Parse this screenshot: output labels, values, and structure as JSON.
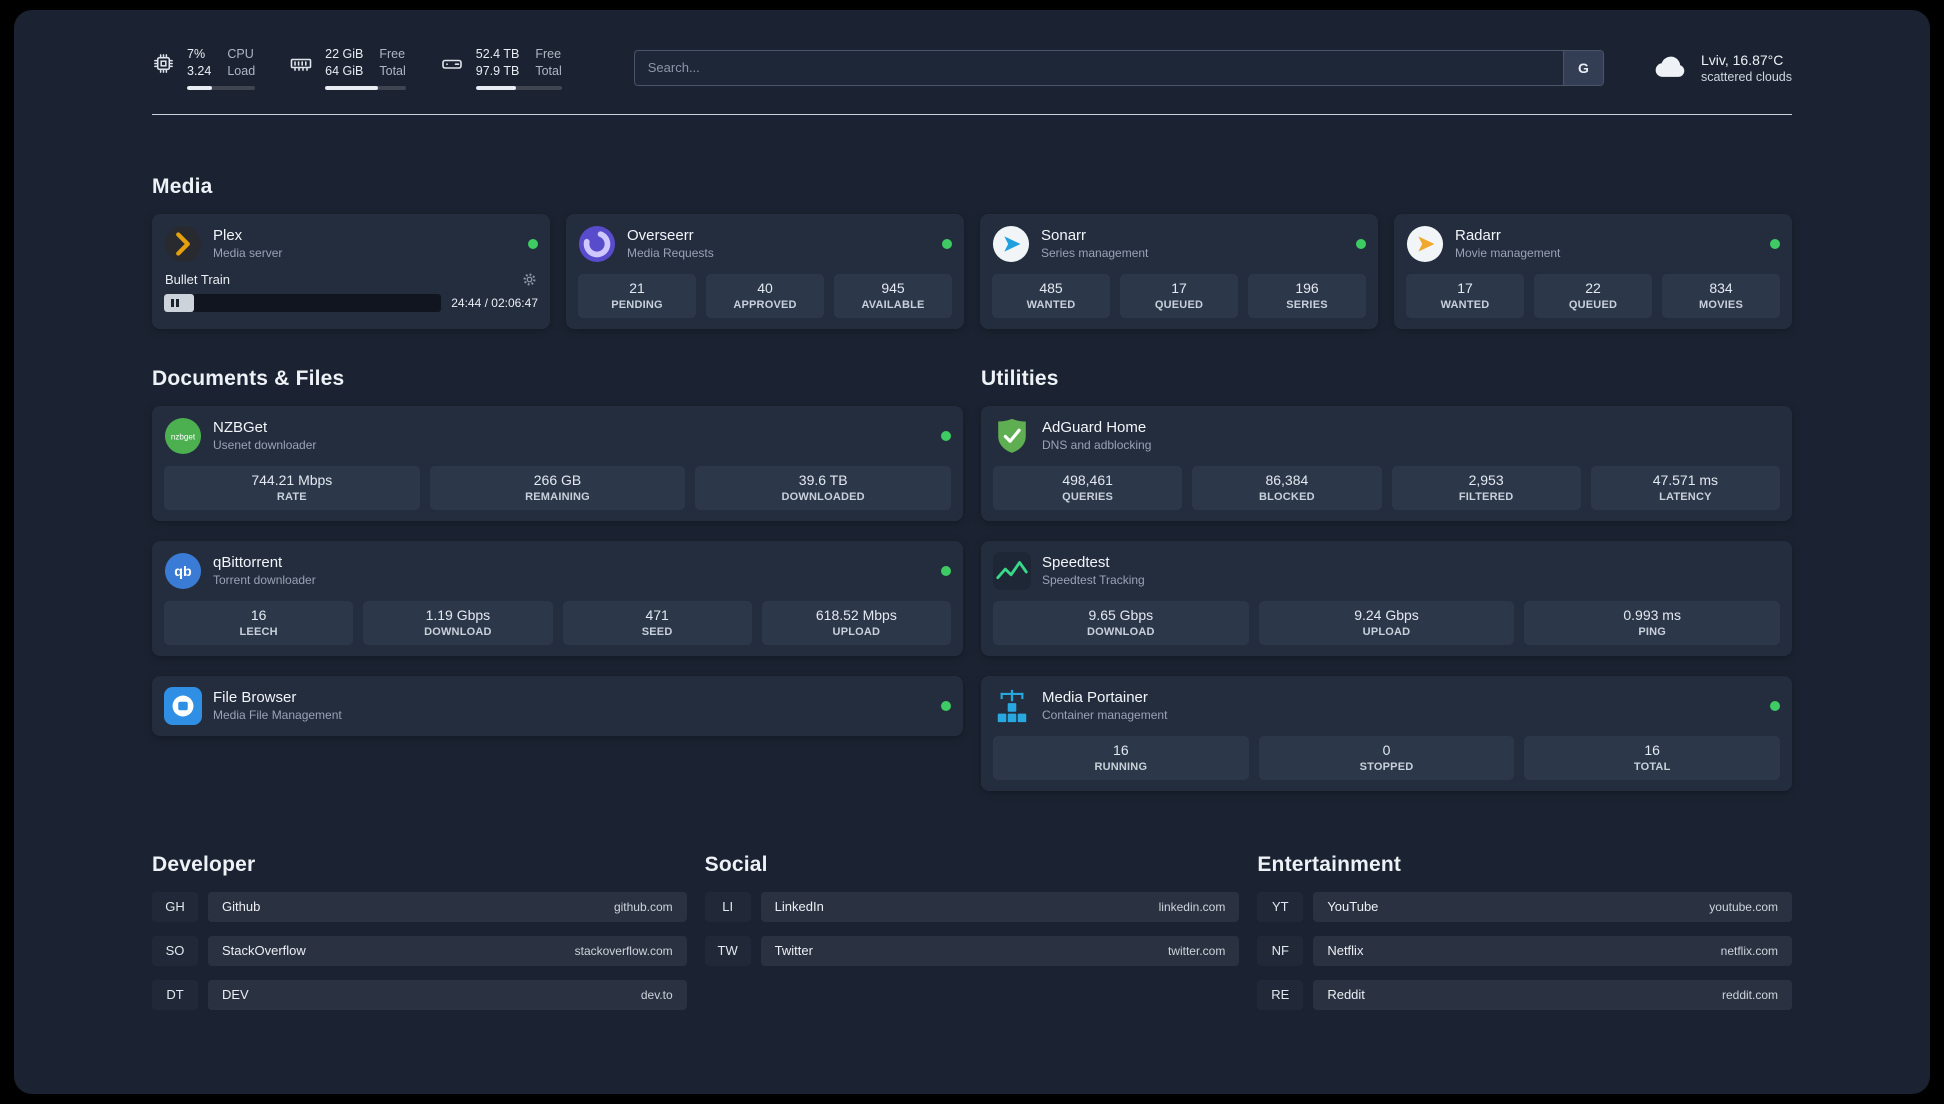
{
  "topbar": {
    "cpu": {
      "value1": "7%",
      "value2": "3.24",
      "label1": "CPU",
      "label2": "Load",
      "progress": 36
    },
    "ram": {
      "value1": "22 GiB",
      "value2": "64 GiB",
      "label1": "Free",
      "label2": "Total",
      "progress": 66
    },
    "disk": {
      "value1": "52.4 TB",
      "value2": "97.9 TB",
      "label1": "Free",
      "label2": "Total",
      "progress": 47
    },
    "search": {
      "placeholder": "Search...",
      "button_label": "G"
    },
    "weather": {
      "location": "Lviv, 16.87°C",
      "condition": "scattered clouds"
    }
  },
  "sections": {
    "media": {
      "title": "Media"
    },
    "documents": {
      "title": "Documents & Files"
    },
    "utilities": {
      "title": "Utilities"
    },
    "developer": {
      "title": "Developer"
    },
    "social": {
      "title": "Social"
    },
    "entertainment": {
      "title": "Entertainment"
    }
  },
  "apps": {
    "plex": {
      "name": "Plex",
      "subtitle": "Media server",
      "now_playing": {
        "title": "Bullet Train",
        "time": "24:44 / 02:06:47",
        "progress": 11
      }
    },
    "overseerr": {
      "name": "Overseerr",
      "subtitle": "Media Requests",
      "stats": [
        {
          "value": "21",
          "label": "PENDING"
        },
        {
          "value": "40",
          "label": "APPROVED"
        },
        {
          "value": "945",
          "label": "AVAILABLE"
        }
      ]
    },
    "sonarr": {
      "name": "Sonarr",
      "subtitle": "Series management",
      "stats": [
        {
          "value": "485",
          "label": "WANTED"
        },
        {
          "value": "17",
          "label": "QUEUED"
        },
        {
          "value": "196",
          "label": "SERIES"
        }
      ]
    },
    "radarr": {
      "name": "Radarr",
      "subtitle": "Movie management",
      "stats": [
        {
          "value": "17",
          "label": "WANTED"
        },
        {
          "value": "22",
          "label": "QUEUED"
        },
        {
          "value": "834",
          "label": "MOVIES"
        }
      ]
    },
    "nzbget": {
      "name": "NZBGet",
      "subtitle": "Usenet downloader",
      "icon_text": "nzbget",
      "stats": [
        {
          "value": "744.21 Mbps",
          "label": "RATE"
        },
        {
          "value": "266 GB",
          "label": "REMAINING"
        },
        {
          "value": "39.6 TB",
          "label": "DOWNLOADED"
        }
      ]
    },
    "qbittorrent": {
      "name": "qBittorrent",
      "subtitle": "Torrent downloader",
      "icon_text": "qb",
      "stats": [
        {
          "value": "16",
          "label": "LEECH"
        },
        {
          "value": "1.19 Gbps",
          "label": "DOWNLOAD"
        },
        {
          "value": "471",
          "label": "SEED"
        },
        {
          "value": "618.52 Mbps",
          "label": "UPLOAD"
        }
      ]
    },
    "filebrowser": {
      "name": "File Browser",
      "subtitle": "Media File Management"
    },
    "adguard": {
      "name": "AdGuard Home",
      "subtitle": "DNS and adblocking",
      "stats": [
        {
          "value": "498,461",
          "label": "QUERIES"
        },
        {
          "value": "86,384",
          "label": "BLOCKED"
        },
        {
          "value": "2,953",
          "label": "FILTERED"
        },
        {
          "value": "47.571 ms",
          "label": "LATENCY"
        }
      ]
    },
    "speedtest": {
      "name": "Speedtest",
      "subtitle": "Speedtest Tracking",
      "stats": [
        {
          "value": "9.65 Gbps",
          "label": "DOWNLOAD"
        },
        {
          "value": "9.24 Gbps",
          "label": "UPLOAD"
        },
        {
          "value": "0.993 ms",
          "label": "PING"
        }
      ]
    },
    "portainer": {
      "name": "Media Portainer",
      "subtitle": "Container management",
      "stats": [
        {
          "value": "16",
          "label": "RUNNING"
        },
        {
          "value": "0",
          "label": "STOPPED"
        },
        {
          "value": "16",
          "label": "TOTAL"
        }
      ]
    }
  },
  "bookmarks": {
    "developer": [
      {
        "abbr": "GH",
        "name": "Github",
        "url": "github.com"
      },
      {
        "abbr": "SO",
        "name": "StackOverflow",
        "url": "stackoverflow.com"
      },
      {
        "abbr": "DT",
        "name": "DEV",
        "url": "dev.to"
      }
    ],
    "social": [
      {
        "abbr": "LI",
        "name": "LinkedIn",
        "url": "linkedin.com"
      },
      {
        "abbr": "TW",
        "name": "Twitter",
        "url": "twitter.com"
      }
    ],
    "entertainment": [
      {
        "abbr": "YT",
        "name": "YouTube",
        "url": "youtube.com"
      },
      {
        "abbr": "NF",
        "name": "Netflix",
        "url": "netflix.com"
      },
      {
        "abbr": "RE",
        "name": "Reddit",
        "url": "reddit.com"
      }
    ]
  }
}
